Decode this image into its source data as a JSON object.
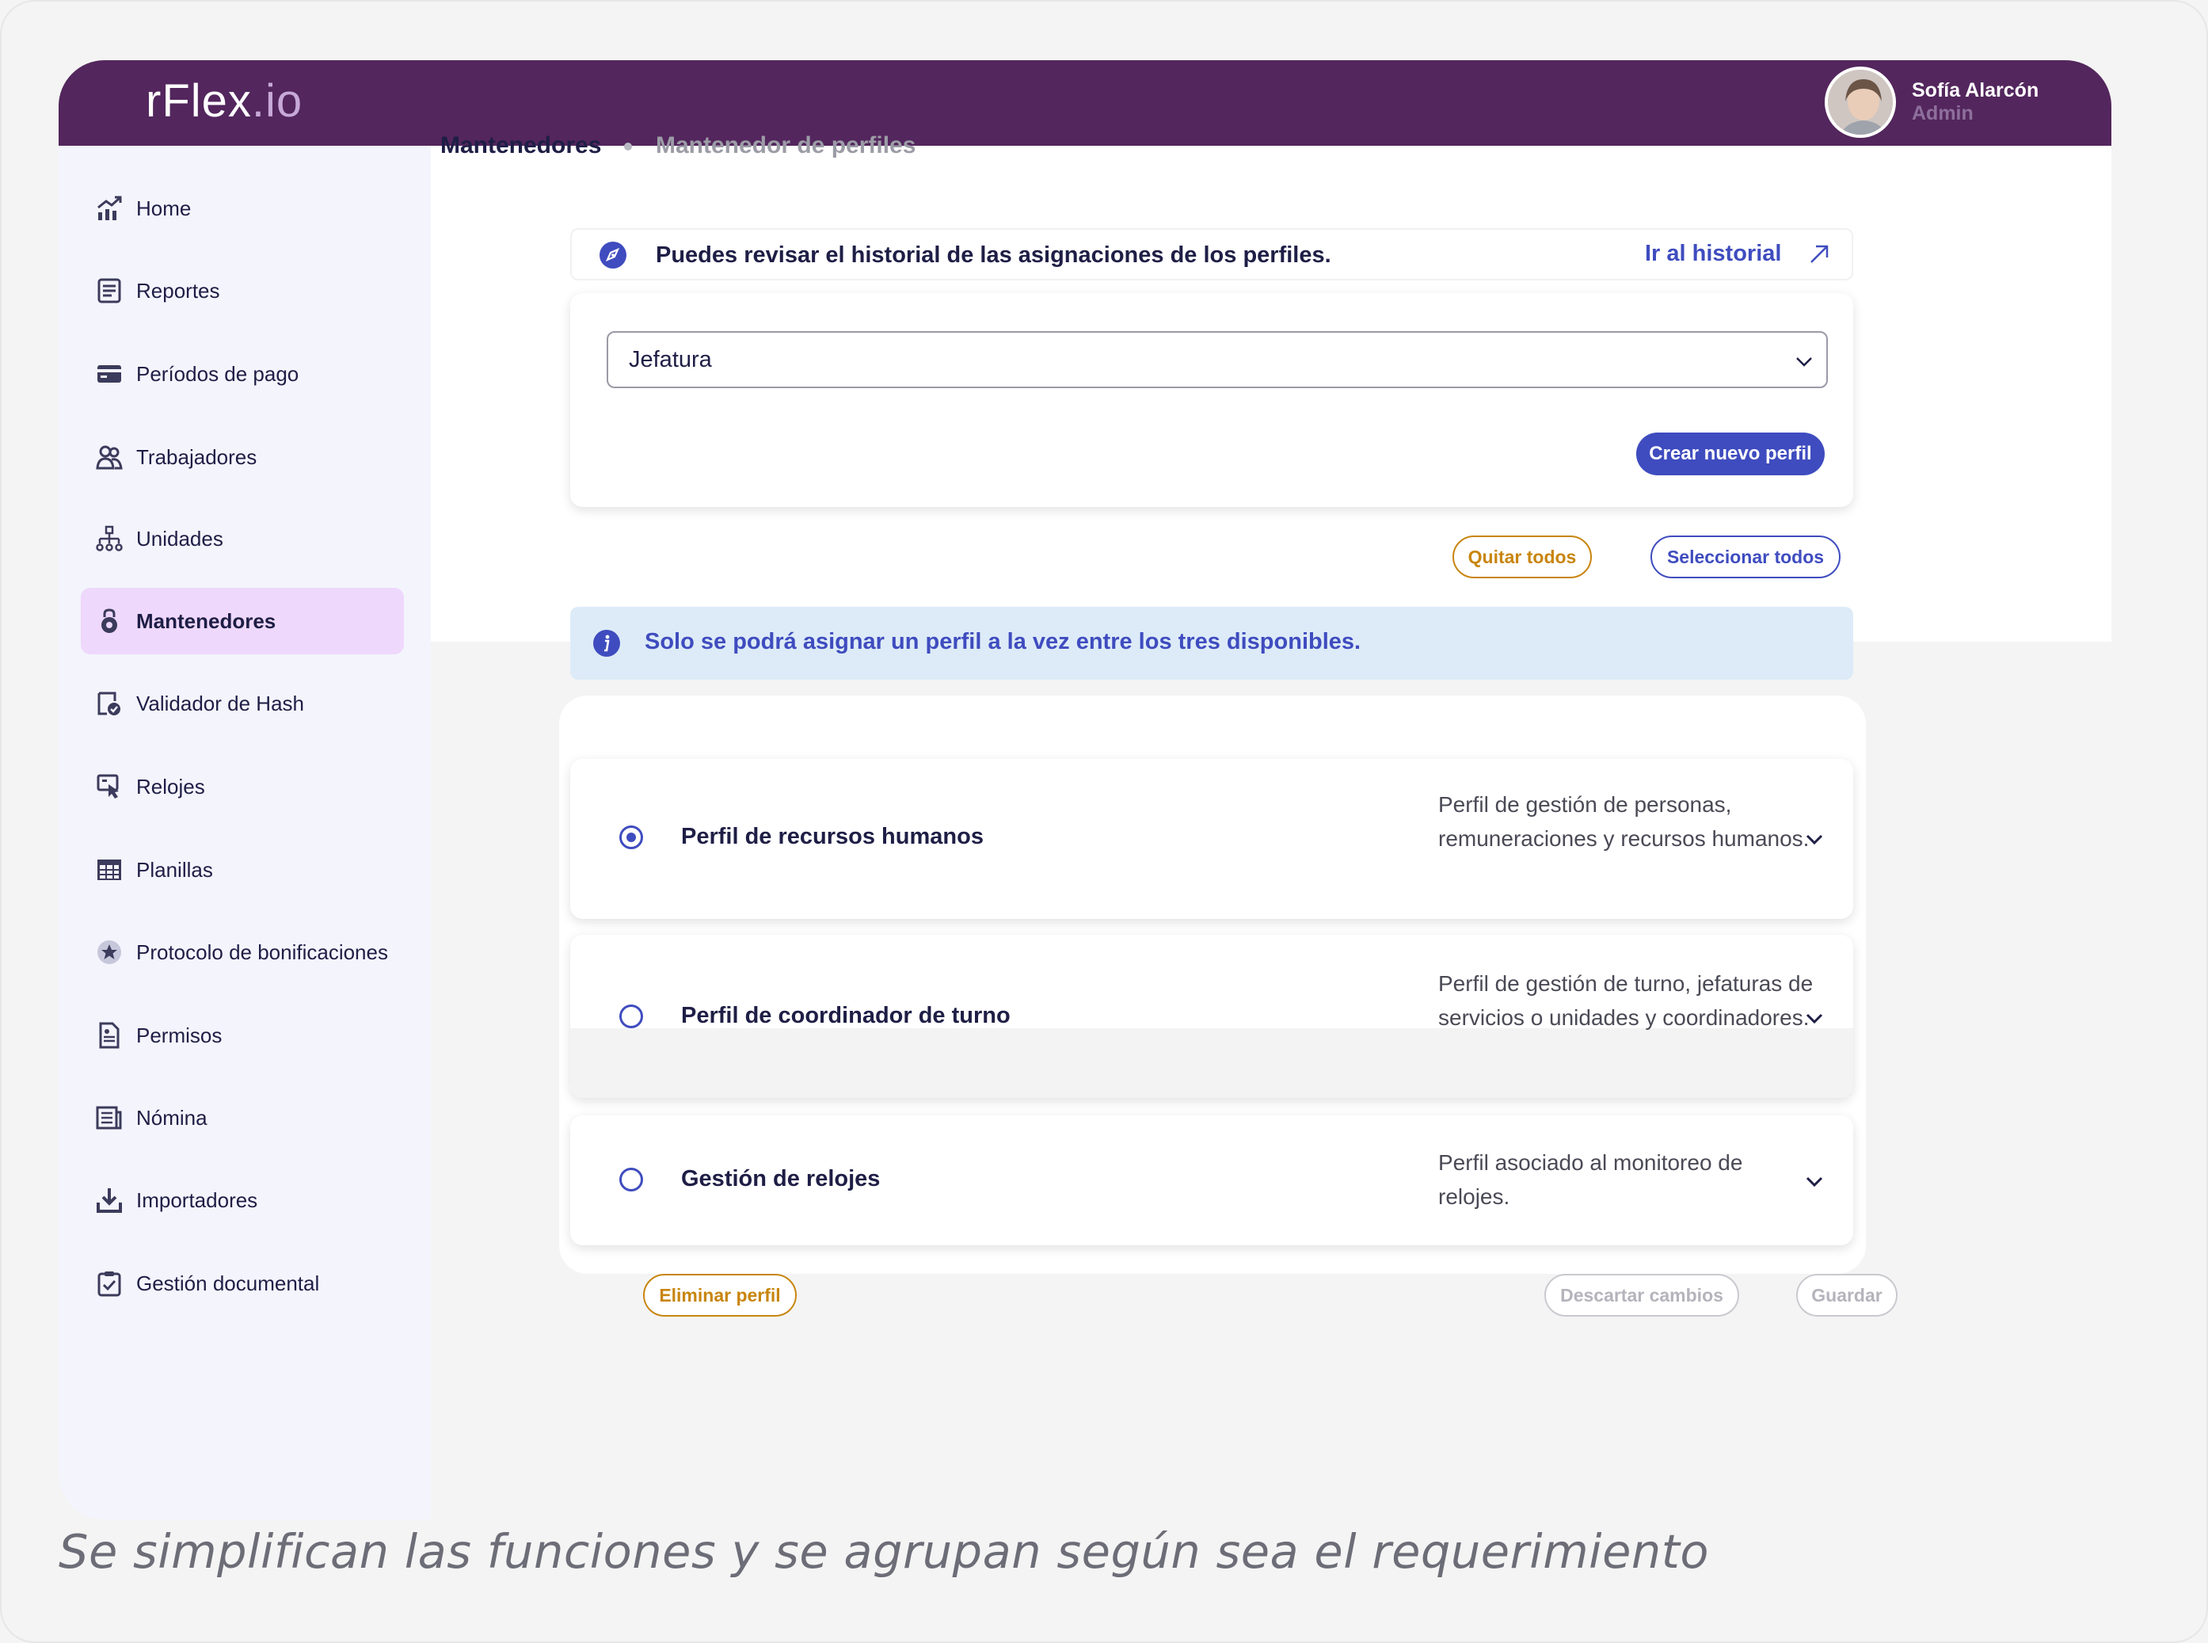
{
  "app": {
    "logo_main": "rFlex",
    "logo_suffix": ".io"
  },
  "user": {
    "name": "Sofía Alarcón",
    "role": "Admin"
  },
  "sidebar": {
    "items": [
      {
        "label": "Home",
        "icon": "chart-trend-icon"
      },
      {
        "label": "Reportes",
        "icon": "report-icon"
      },
      {
        "label": "Períodos de pago",
        "icon": "payment-card-icon"
      },
      {
        "label": "Trabajadores",
        "icon": "workers-icon"
      },
      {
        "label": "Unidades",
        "icon": "org-tree-icon"
      },
      {
        "label": "Mantenedores",
        "icon": "gear-lock-icon",
        "active": true
      },
      {
        "label": "Validador de Hash",
        "icon": "hash-validator-icon"
      },
      {
        "label": "Relojes",
        "icon": "clock-device-icon"
      },
      {
        "label": "Planillas",
        "icon": "spreadsheet-icon"
      },
      {
        "label": "Protocolo de bonificaciones",
        "icon": "star-badge-icon"
      },
      {
        "label": "Permisos",
        "icon": "permit-document-icon"
      },
      {
        "label": "Nómina",
        "icon": "payroll-icon"
      },
      {
        "label": "Importadores",
        "icon": "import-icon"
      },
      {
        "label": "Gestión documental",
        "icon": "clipboard-check-icon"
      }
    ]
  },
  "breadcrumb": {
    "root": "Mantenedores",
    "current": "Mantenedor de perfiles"
  },
  "history": {
    "text": "Puedes revisar el historial de las asignaciones de los perfiles.",
    "link": "Ir al historial"
  },
  "profile_select": {
    "value": "Jefatura",
    "create_button": "Crear nuevo perfil"
  },
  "bulk_actions": {
    "remove_all": "Quitar todos",
    "select_all": "Seleccionar todos"
  },
  "info": {
    "text": "Solo se podrá asignar un perfil a la vez entre los tres disponibles."
  },
  "profiles": [
    {
      "title": "Perfil de recursos humanos",
      "description": "Perfil de gestión de personas, remuneraciones y recursos humanos.",
      "selected": true
    },
    {
      "title": "Perfil de coordinador de turno",
      "description": "Perfil de gestión de turno, jefaturas de servicios o unidades y coordinadores.",
      "selected": false
    },
    {
      "title": "Gestión de relojes",
      "description": "Perfil asociado al monitoreo de relojes.",
      "selected": false
    }
  ],
  "footer_actions": {
    "delete": "Eliminar perfil",
    "discard": "Descartar cambios",
    "save": "Guardar"
  },
  "caption": "Se simplifican las funciones y se agrupan según sea el requerimiento",
  "colors": {
    "header": "#53265d",
    "sidebar": "#f4f4fd",
    "active_item": "#eed8fb",
    "primary": "#3f4cbf",
    "warning": "#c8850e",
    "info_bg": "#ddebf8"
  }
}
